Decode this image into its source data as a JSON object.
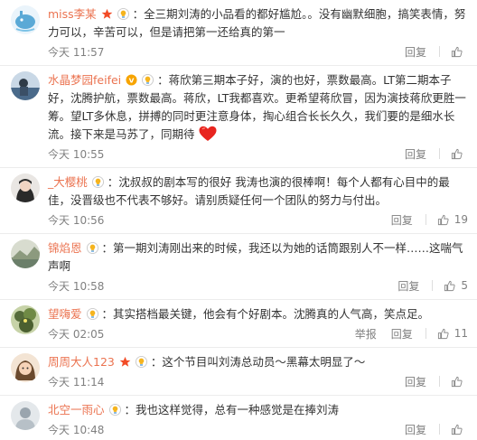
{
  "comments": [
    {
      "user": "miss李某",
      "colon": "：",
      "text": "全三期刘涛的小品看的都好尴尬。。没有幽默细胞，搞笑表情，努力可以，辛苦可以，但是请把第一还给真的第一",
      "time": "今天 11:57",
      "reply": "回复",
      "likes": "",
      "avatar_color": "#5aa9d6",
      "badges": [
        "star-icon",
        "bulb-icon"
      ]
    },
    {
      "user": "水晶梦园feifei",
      "colon": "：",
      "text": "蒋欣第三期本子好，演的也好，票数最高。LT第二期本子好，沈腾护航，票数最高。蒋欣，LT我都喜欢。更希望蒋欣冒，因为演技蒋欣更胜一筹。望LT多休息，拼搏的同时更注意身体，掏心组合长长久久，我们要的是细水长流。接下来是马苏了，同期待",
      "time": "今天 10:55",
      "reply": "回复",
      "likes": "",
      "avatar_color": "#4a6a8a",
      "badges": [
        "vip-icon",
        "bulb-icon"
      ]
    },
    {
      "user": "_大樱桃",
      "colon": "：",
      "text": "沈叔叔的剧本写的很好 我涛也演的很棒啊！每个人都有心目中的最佳，没晋级也不代表不够好。请别质疑任何一个团队的努力与付出。",
      "time": "今天 10:56",
      "reply": "回复",
      "likes": "19",
      "avatar_color": "#3b3b3b",
      "badges": [
        "bulb-icon"
      ]
    },
    {
      "user": "锦焰恩",
      "colon": "：",
      "text": "第一期刘涛刚出来的时候，我还以为她的话筒跟别人不一样……这喘气声啊",
      "time": "今天 10:58",
      "reply": "回复",
      "likes": "5",
      "avatar_color": "#6b7f6a",
      "badges": [
        "bulb-icon"
      ]
    },
    {
      "user": "望嗨爱",
      "colon": "：",
      "text": "其实搭档最关键，他会有个好剧本。沈腾真的人气高，笑点足。",
      "time": "今天 02:05",
      "report": "举报",
      "reply": "回复",
      "likes": "11",
      "avatar_color": "#556b3a",
      "badges": [
        "bulb-icon"
      ]
    },
    {
      "user": "周周大人123",
      "colon": "：",
      "text": "这个节目叫刘涛总动员～黑幕太明显了～",
      "time": "今天 11:14",
      "reply": "回复",
      "likes": "",
      "avatar_color": "#d9a77a",
      "badges": [
        "star-icon",
        "bulb-icon"
      ]
    },
    {
      "user": "北空一雨心",
      "colon": "：",
      "text": "我也这样觉得，总有一种感觉是在捧刘涛",
      "time": "今天 10:48",
      "reply": "回复",
      "likes": "",
      "avatar_color": "#9aa5ae",
      "badges": [
        "bulb-icon"
      ]
    }
  ]
}
